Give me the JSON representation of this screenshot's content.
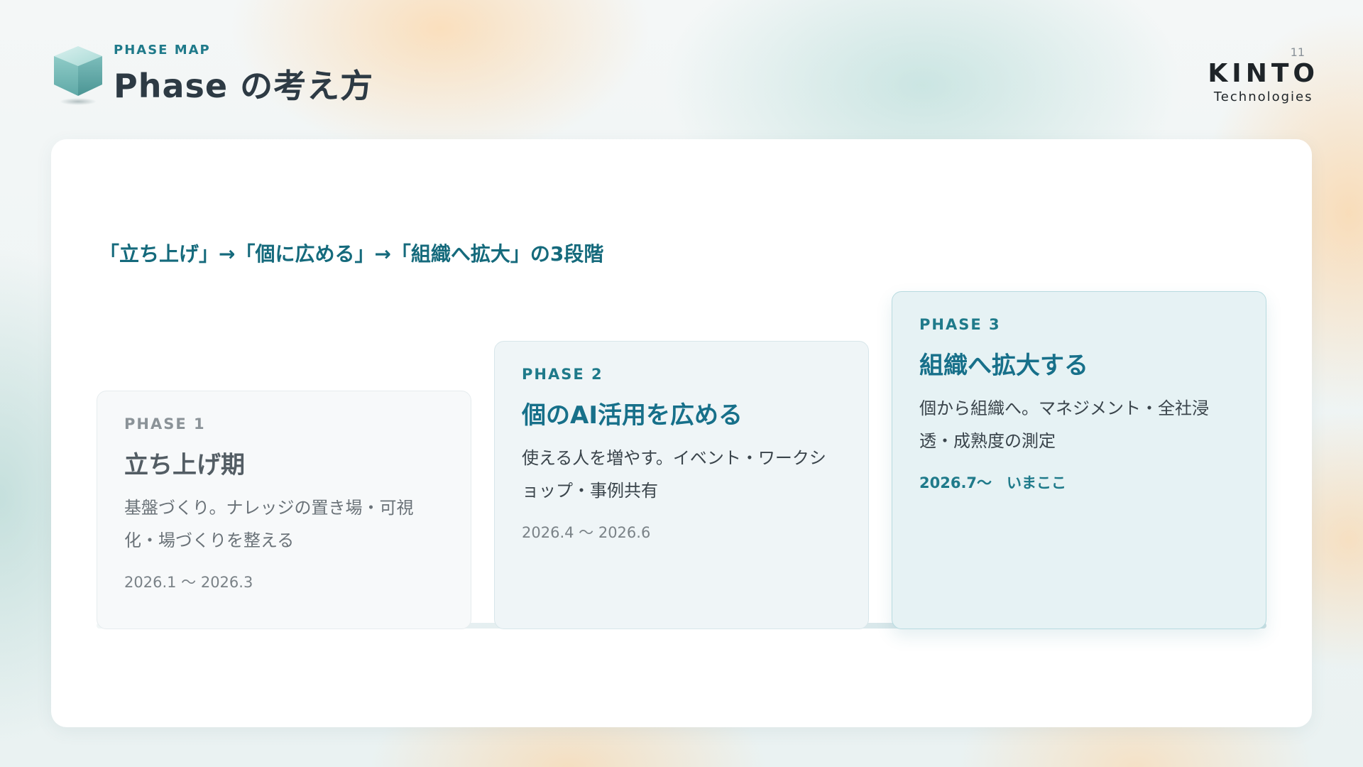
{
  "header": {
    "eyebrow": "PHASE MAP",
    "title": "Phase の考え方",
    "page_number": "11"
  },
  "logo": {
    "main": "KINTO",
    "sub": "Technologies"
  },
  "panel": {
    "lead": "「立ち上げ」→「個に広める」→「組織へ拡大」の3段階"
  },
  "phases": [
    {
      "label": "PHASE 1",
      "title": "立ち上げ期",
      "description": "基盤づくり。ナレッジの置き場・可視化・場づくりを整える",
      "period": "2026.1 〜 2026.3"
    },
    {
      "label": "PHASE 2",
      "title": "個のAI活用を広める",
      "description": "使える人を増やす。イベント・ワークショップ・事例共有",
      "period": "2026.4 〜 2026.6"
    },
    {
      "label": "PHASE 3",
      "title": "組織へ拡大する",
      "description": "個から組織へ。マネジメント・全社浸透・成熟度の測定",
      "period": "2026.7〜　いまここ"
    }
  ],
  "colors": {
    "accent": "#1f7a8a",
    "title_dark": "#2d3a44",
    "current_card_bg": "#e6f2f4"
  },
  "icons": {
    "header": "cube-icon"
  }
}
